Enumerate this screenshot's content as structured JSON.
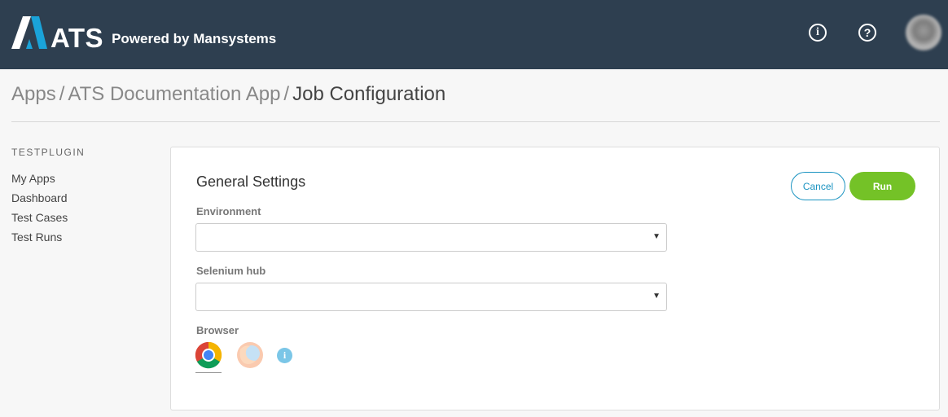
{
  "header": {
    "logo_text": "ATS",
    "powered_by": "Powered by Mansystems",
    "info_icon_glyph": "i",
    "help_icon_glyph": "?",
    "brand_color": "#1aa3d9",
    "bar_color": "#2e3f50"
  },
  "breadcrumb": {
    "items": [
      "Apps",
      "ATS Documentation App"
    ],
    "separator": "/",
    "current": "Job Configuration"
  },
  "sidebar": {
    "title": "TESTPLUGIN",
    "items": [
      {
        "label": "My Apps"
      },
      {
        "label": "Dashboard"
      },
      {
        "label": "Test Cases"
      },
      {
        "label": "Test Runs"
      }
    ]
  },
  "card": {
    "title": "General Settings",
    "cancel_label": "Cancel",
    "run_label": "Run",
    "environment": {
      "label": "Environment",
      "value": ""
    },
    "selenium_hub": {
      "label": "Selenium hub",
      "value": ""
    },
    "browser": {
      "label": "Browser",
      "options": [
        {
          "icon": "chrome-icon",
          "selected": true
        },
        {
          "icon": "firefox-icon",
          "selected": false
        }
      ],
      "info_glyph": "i"
    }
  },
  "colors": {
    "accent": "#1a93c1",
    "run_button": "#74c227"
  }
}
